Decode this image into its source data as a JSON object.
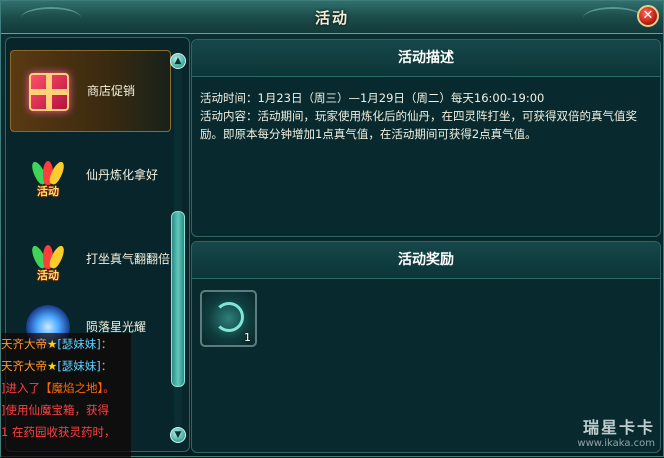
{
  "window": {
    "title": "活动",
    "close_label": "✕"
  },
  "activity_list": [
    {
      "label": "商店促销",
      "icon": "gift-box-icon",
      "selected": true
    },
    {
      "label": "仙丹炼化拿好",
      "icon": "fireworks-icon",
      "badge": "活动",
      "selected": false
    },
    {
      "label": "打坐真气翻翻倍",
      "icon": "fireworks-icon",
      "badge": "活动",
      "selected": false
    },
    {
      "label": "陨落星光耀",
      "icon": "star-orb-icon",
      "selected": false
    }
  ],
  "description": {
    "heading": "活动描述",
    "time": "活动时间：1月23日（周三）—1月29日（周二）每天16:00-19:00",
    "content": "活动内容：活动期间，玩家使用炼化后的仙丹，在四灵阵打坐，可获得双倍的真气值奖励。即原本每分钟增加1点真气值，在活动期间可获得2点真气值。"
  },
  "rewards": {
    "heading": "活动奖励",
    "items": [
      {
        "icon": "jade-swirl-icon",
        "count": "1"
      }
    ]
  },
  "chat": [
    {
      "name": "天齐大帝",
      "star": "★",
      "tag": "[瑟妹妹]",
      "tail": "："
    },
    {
      "name": "天齐大帝",
      "star": "★",
      "tag": "[瑟妹妹]",
      "tail": "："
    },
    {
      "prefix": "]进入了",
      "place": "【魔焰之地】",
      "tail": "。"
    },
    {
      "prefix": "]使用仙魔宝箱，获得",
      "place": "",
      "tail": ""
    },
    {
      "prefix": "1 在药园收获灵药时，",
      "place": "",
      "tail": ""
    }
  ],
  "watermark": {
    "title": "瑞星卡卡",
    "url": "www.ikaka.com"
  },
  "colors": {
    "accent": "#5fa39e",
    "selected": "#8a6a2a",
    "chat_name": "#ff9a2e",
    "chat_system": "#ff4040"
  }
}
